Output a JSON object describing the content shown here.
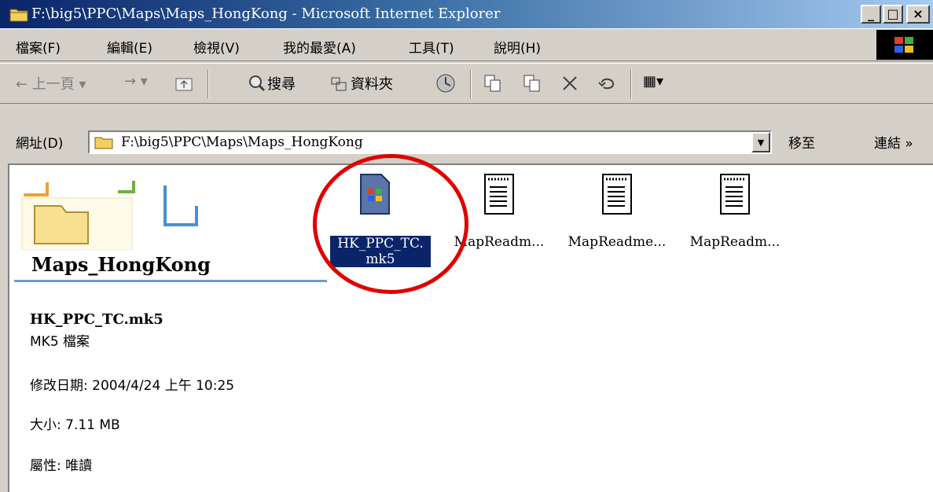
{
  "window": {
    "title": "F:\\big5\\PPC\\Maps\\Maps_HongKong - Microsoft Internet Explorer",
    "minimize_label": "_",
    "maximize_label": "□",
    "close_label": "×"
  },
  "menu": {
    "items": [
      {
        "label": "檔案(F)"
      },
      {
        "label": "編輯(E)"
      },
      {
        "label": "檢視(V)"
      },
      {
        "label": "我的最愛(A)"
      },
      {
        "label": "工具(T)"
      },
      {
        "label": "說明(H)"
      }
    ]
  },
  "toolbar": {
    "back_label": "← 上一頁 ▾",
    "forward_label": "→ ▾",
    "search_label": "搜尋",
    "folders_label": "資料夾",
    "views_label": "▦▾"
  },
  "address": {
    "label": "網址(D)",
    "value": "F:\\big5\\PPC\\Maps\\Maps_HongKong",
    "go_label": "移至",
    "links_label": "連結 »"
  },
  "folder": {
    "title": "Maps_HongKong"
  },
  "files": [
    {
      "name_line1": "HK_PPC_TC.",
      "name_line2": "mk5"
    },
    {
      "name": "MapReadm..."
    },
    {
      "name": "MapReadme..."
    },
    {
      "name": "MapReadm..."
    }
  ],
  "details": {
    "name": "HK_PPC_TC.mk5",
    "type": "MK5 檔案",
    "modified": "修改日期: 2004/4/24 上午 10:25",
    "size": "大小: 7.11 MB",
    "attributes": "屬性: 唯讀"
  },
  "colors": {
    "title_gradient_start": "#0a246a",
    "title_gradient_end": "#a6caf0",
    "selection": "#0a246a",
    "highlight_circle": "#e00000",
    "folder_underline": "#6c9bd2"
  }
}
